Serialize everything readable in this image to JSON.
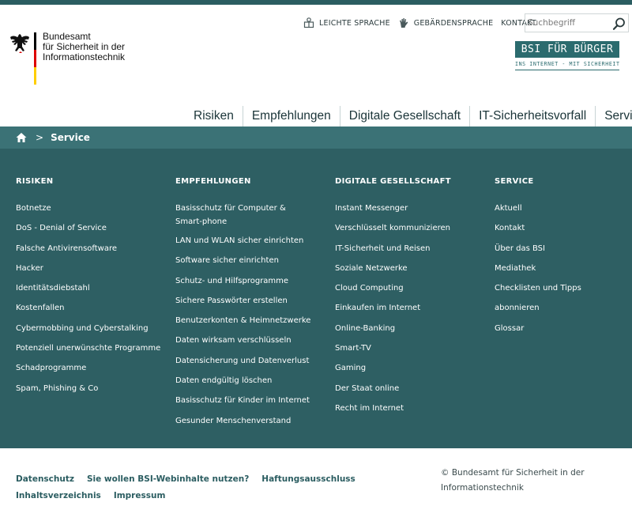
{
  "logo": {
    "lines": [
      "Bundesamt",
      "für Sicherheit in der",
      "Informationstechnik"
    ]
  },
  "meta_nav": {
    "items": [
      {
        "label": "LEICHTE SPRACHE",
        "icon": "easy-language-icon"
      },
      {
        "label": "GEBÄRDENSPRACHE",
        "icon": "sign-language-hand-icon"
      },
      {
        "label": "KONTAKT",
        "icon": ""
      }
    ]
  },
  "search": {
    "placeholder": "Suchbegriff",
    "icon": "search-icon"
  },
  "buerger": {
    "title": "BSI FÜR BÜRGER",
    "subtitle": "INS INTERNET - MIT SICHERHEIT"
  },
  "main_nav": {
    "items": [
      "Risiken",
      "Empfehlungen",
      "Digitale Gesellschaft",
      "IT-Sicherheitsvorfall",
      "Service"
    ]
  },
  "breadcrumb": {
    "separator": ">",
    "current": "Service",
    "home_icon": "home-icon"
  },
  "sitemap": {
    "columns": [
      {
        "heading": "RISIKEN",
        "links": [
          "Botnetze",
          "DoS - Denial of Service",
          "Falsche Antivirensoftware",
          "Hacker",
          "Identitätsdiebstahl",
          "Kostenfallen",
          "Cybermobbing und Cyberstalking",
          "Potenziell unerwünschte Programme",
          "Schadprogramme",
          "Spam, Phishing & Co"
        ]
      },
      {
        "heading": "EMPFEHLUNGEN",
        "links": [
          "Basisschutz für Computer & Smart-phone",
          "LAN und WLAN sicher einrichten",
          "Software sicher einrichten",
          "Schutz- und Hilfsprogramme",
          "Sichere Passwörter erstellen",
          "Benutzerkonten & Heimnetzwerke",
          "Daten wirksam verschlüsseln",
          "Datensicherung und Datenverlust",
          "Daten endgültig löschen",
          "Basisschutz für Kinder im Internet",
          "Gesunder Menschenverstand"
        ]
      },
      {
        "heading": "DIGITALE GESELLSCHAFT",
        "links": [
          "Instant Messenger",
          "Verschlüsselt kommunizieren",
          "IT-Sicherheit und Reisen",
          "Soziale Netzwerke",
          "Cloud Computing",
          "Einkaufen im Internet",
          "Online-Banking",
          "Smart-TV",
          "Gaming",
          "Der Staat online",
          "Recht im Internet"
        ]
      },
      {
        "heading": "SERVICE",
        "links": [
          "Aktuell",
          "Kontakt",
          "Über das BSI",
          "Mediathek",
          "Checklisten und Tipps",
          "abonnieren",
          "Glossar"
        ]
      }
    ]
  },
  "footer": {
    "links": [
      "Datenschutz",
      "Sie wollen BSI-Webinhalte nutzen?",
      "Haftungsausschluss",
      "Inhaltsverzeichnis",
      "Impressum"
    ],
    "copyright": "© Bundesamt für Sicherheit in der Informationstechnik"
  },
  "colors": {
    "teal_dark": "#2e5f63",
    "teal_breadcrumb": "#3b7276",
    "brand_badge": "#2b6b6e",
    "flag_black": "#000000",
    "flag_red": "#dd0000",
    "flag_gold": "#ffce00"
  }
}
